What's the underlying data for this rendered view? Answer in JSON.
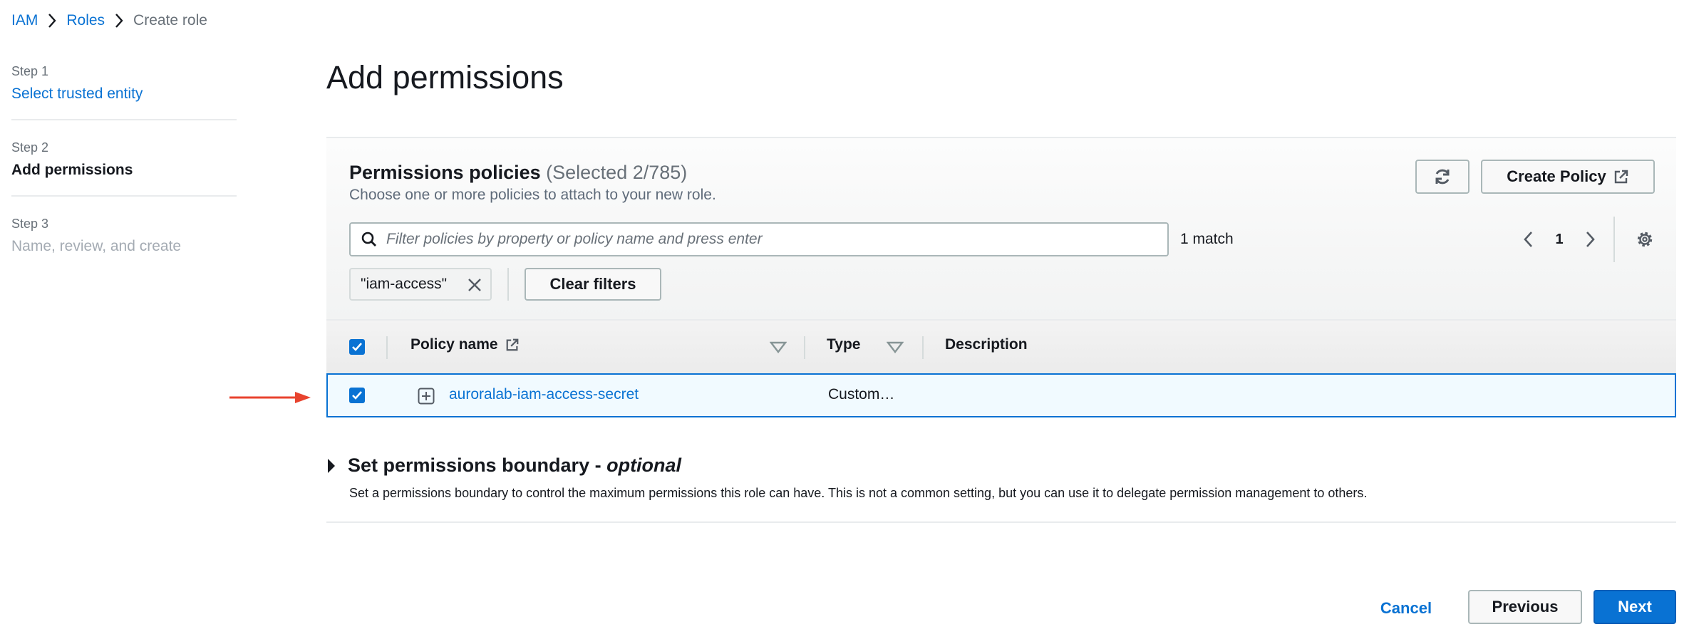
{
  "breadcrumb": {
    "items": [
      "IAM",
      "Roles"
    ],
    "current": "Create role"
  },
  "steps": [
    {
      "number": "Step 1",
      "title": "Select trusted entity",
      "state": "link"
    },
    {
      "number": "Step 2",
      "title": "Add permissions",
      "state": "active"
    },
    {
      "number": "Step 3",
      "title": "Name, review, and create",
      "state": "disabled"
    }
  ],
  "page_title": "Add permissions",
  "policies": {
    "title": "Permissions policies",
    "count": "(Selected 2/785)",
    "description": "Choose one or more policies to attach to your new role.",
    "refresh_icon": "refresh-icon",
    "create_policy_label": "Create Policy",
    "search_placeholder": "Filter policies by property or policy name and press enter",
    "match_text": "1 match",
    "page_number": "1",
    "filter_token": "\"iam-access\"",
    "clear_filters_label": "Clear filters",
    "columns": {
      "policy_name": "Policy name",
      "type": "Type",
      "description": "Description"
    },
    "rows": [
      {
        "name": "auroralab-iam-access-secret",
        "type": "Custom…",
        "description": "",
        "selected": true
      }
    ]
  },
  "boundary": {
    "title": "Set permissions boundary - ",
    "title_em": "optional",
    "description": "Set a permissions boundary to control the maximum permissions this role can have. This is not a common setting, but you can use it to delegate permission management to others."
  },
  "footer": {
    "cancel_label": "Cancel",
    "previous_label": "Previous",
    "next_label": "Next"
  },
  "colors": {
    "accent": "#0972d3",
    "annotation_arrow": "#e8432e"
  }
}
